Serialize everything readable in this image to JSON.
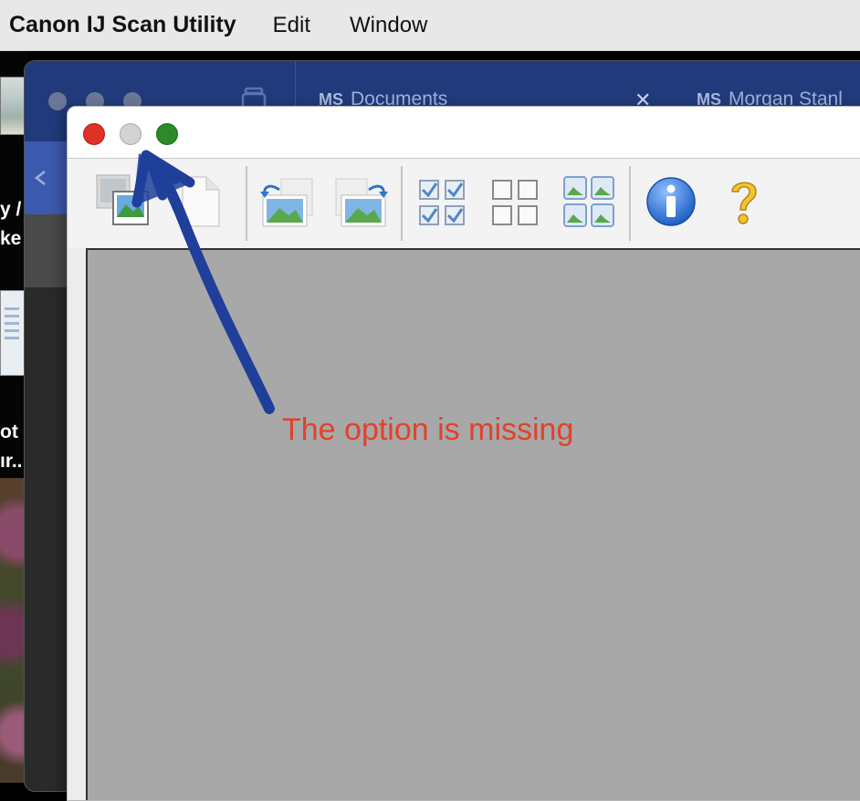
{
  "menubar": {
    "app_name": "Canon IJ Scan Utility",
    "items": [
      {
        "label": "Edit"
      },
      {
        "label": "Window"
      }
    ]
  },
  "background_window": {
    "tabs": [
      {
        "badge": "MS",
        "label": "Documents"
      },
      {
        "badge": "MS",
        "label": "Morgan Stanl"
      }
    ],
    "close_glyph": "✕",
    "side_fragments": [
      "y /",
      "ke",
      "ot",
      "ır.."
    ]
  },
  "canon_window": {
    "toolbar": [
      {
        "name": "scan-image-icon"
      },
      {
        "name": "blank-page-icon"
      },
      {
        "name": "rotate-left-icon"
      },
      {
        "name": "rotate-right-icon"
      },
      {
        "name": "select-all-icon"
      },
      {
        "name": "deselect-all-icon"
      },
      {
        "name": "thumbnail-view-icon"
      },
      {
        "name": "info-icon"
      },
      {
        "name": "help-icon"
      }
    ]
  },
  "annotation": {
    "text": "The option is missing",
    "color": "#e2412b",
    "arrow_color": "#1f3f9a"
  }
}
